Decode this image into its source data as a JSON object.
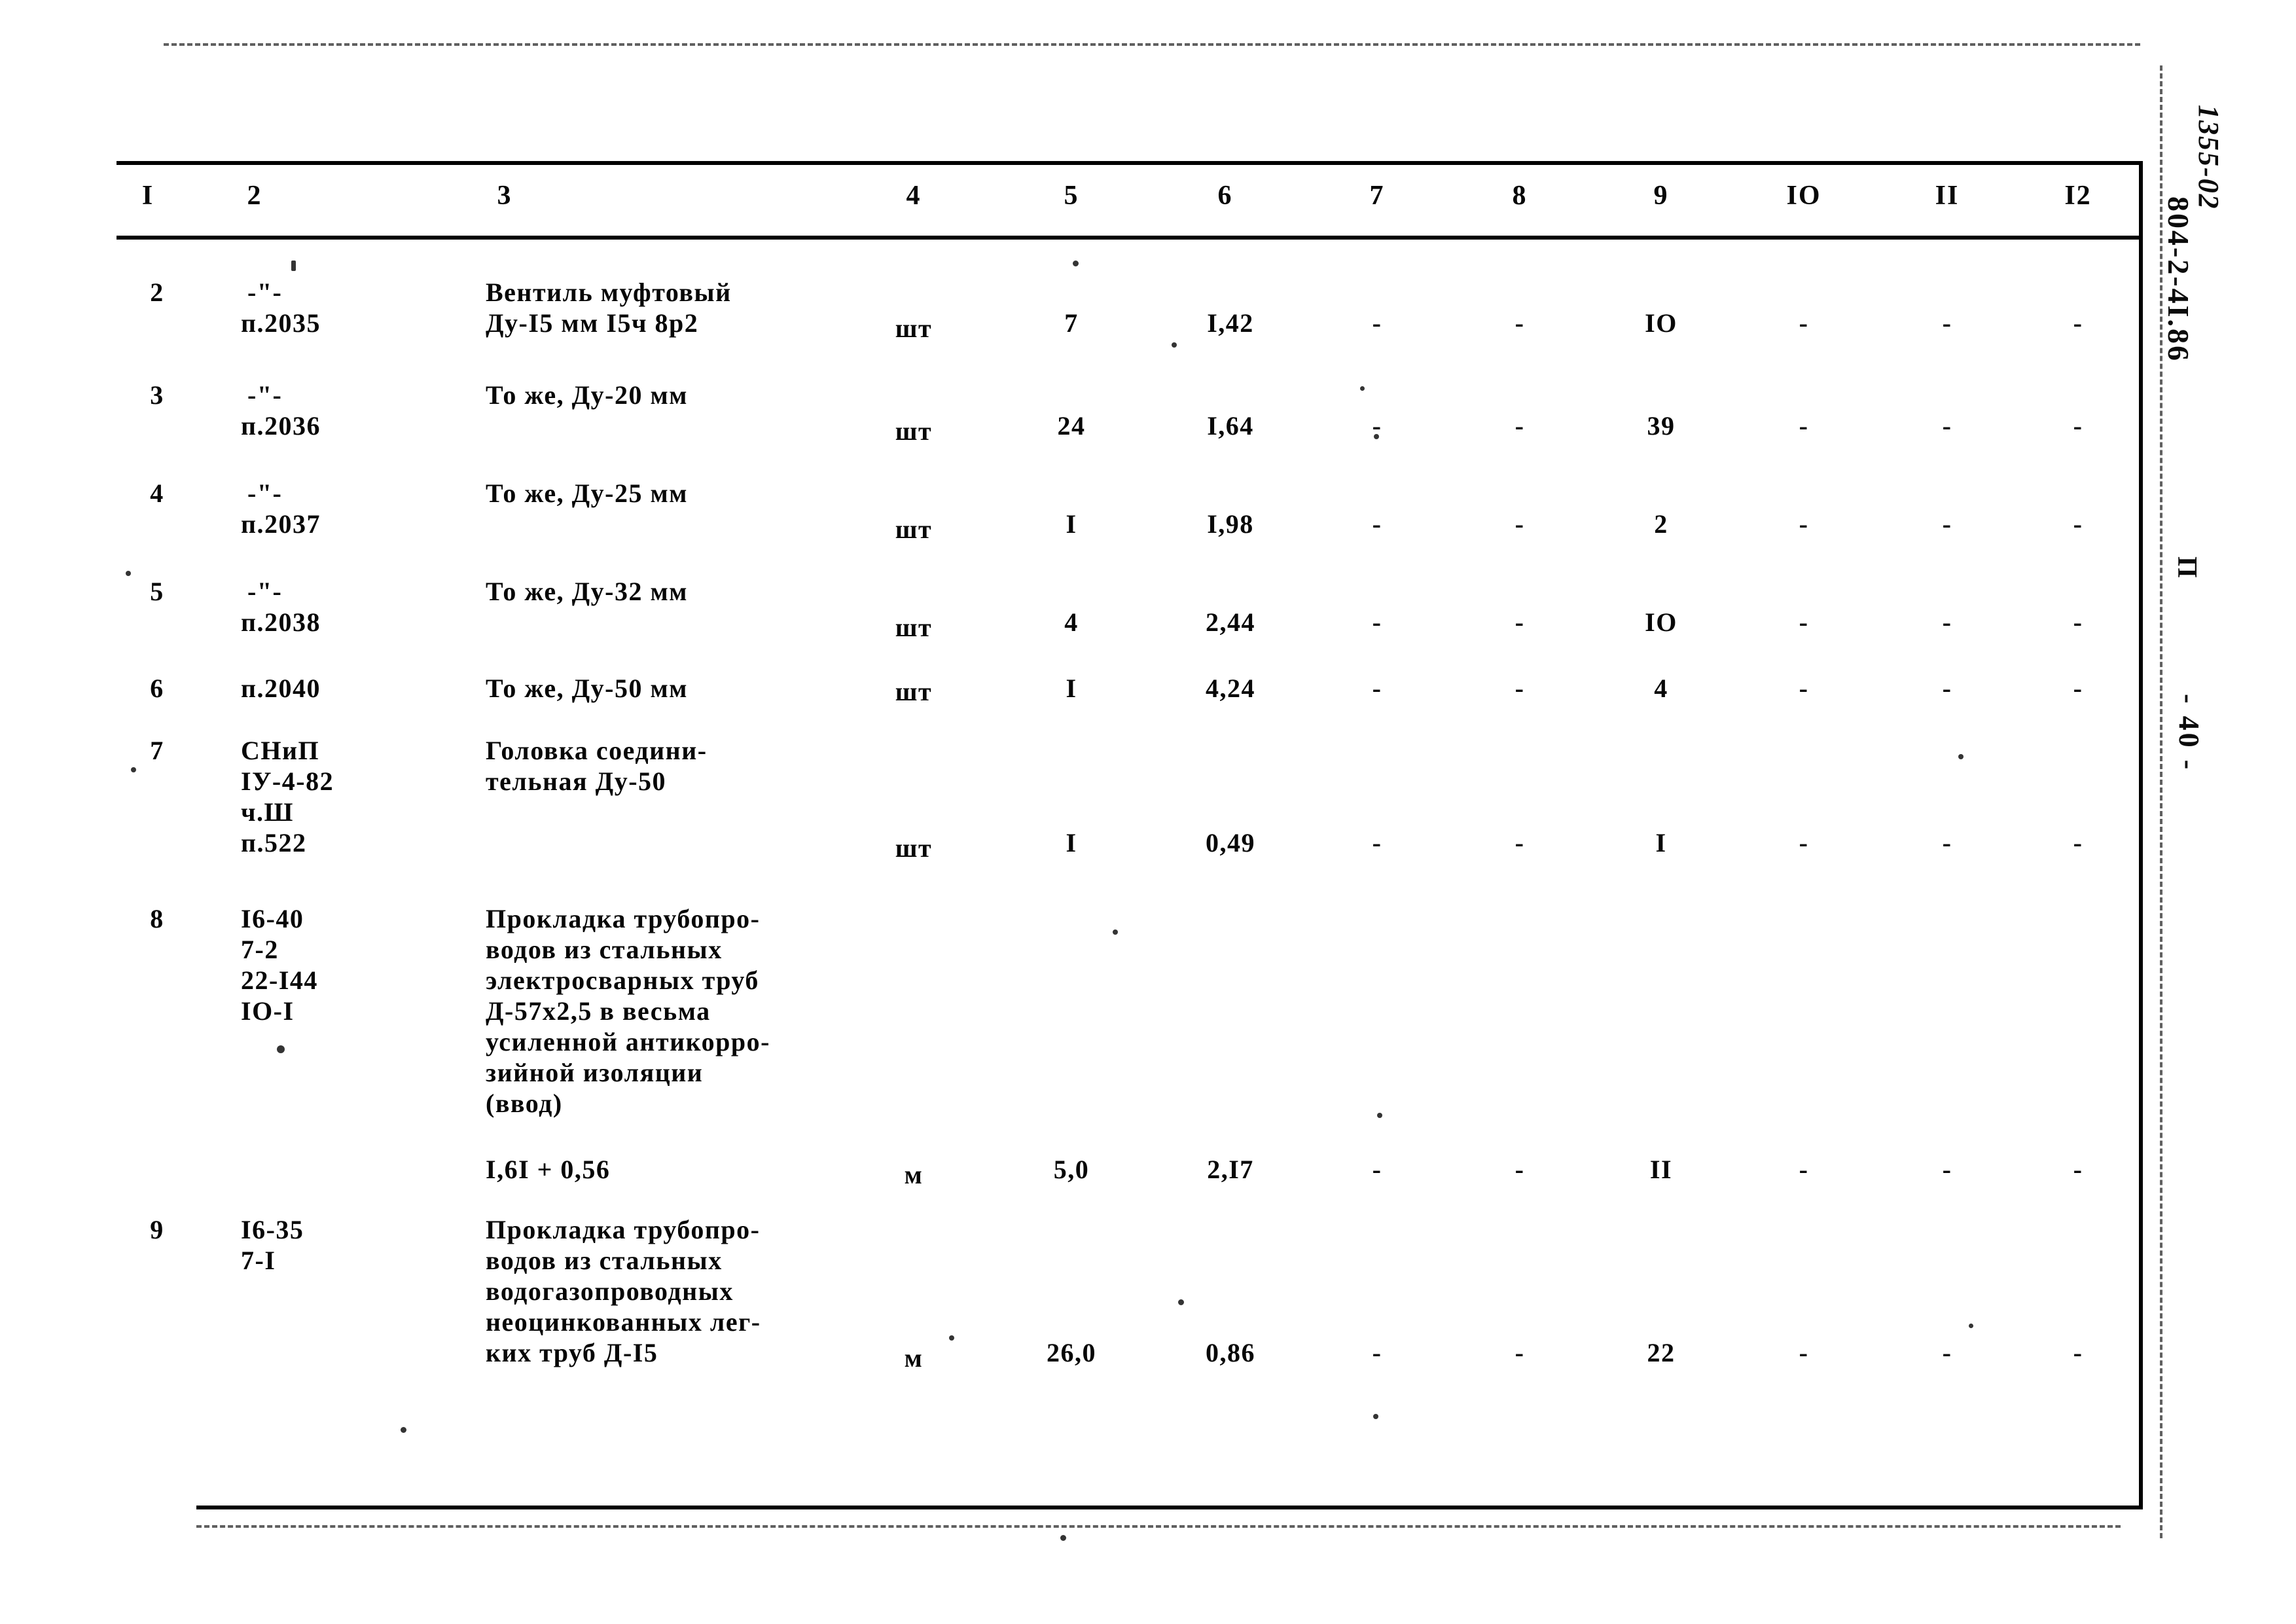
{
  "document": {
    "kind": "scanned-estimate-table",
    "margin_code_handwritten": "1355-02",
    "margin_code_printed": "804-2-4I.86",
    "margin_part": "П",
    "page_marker": "- 40 -"
  },
  "table": {
    "headers": [
      "I",
      "2",
      "3",
      "4",
      "5",
      "6",
      "7",
      "8",
      "9",
      "IO",
      "II",
      "I2"
    ],
    "rows": [
      {
        "num": "2",
        "code": [
          "-\"-",
          "п.2035"
        ],
        "desc": [
          "Вентиль муфтовый",
          "Ду-I5 мм I5ч 8р2"
        ],
        "unit": "шт",
        "c5": "7",
        "c6": "I,42",
        "c7": "-",
        "c8": "-",
        "c9": "IO",
        "c10": "-",
        "c11": "-",
        "c12": "-"
      },
      {
        "num": "3",
        "code": [
          "-\"-",
          "п.2036"
        ],
        "desc": [
          "То же, Ду-20 мм"
        ],
        "unit": "шт",
        "c5": "24",
        "c6": "I,64",
        "c7": "-",
        "c8": "-",
        "c9": "39",
        "c10": "-",
        "c11": "-",
        "c12": "-"
      },
      {
        "num": "4",
        "code": [
          "-\"-",
          "п.2037"
        ],
        "desc": [
          "То же, Ду-25 мм"
        ],
        "unit": "шт",
        "c5": "I",
        "c6": "I,98",
        "c7": "-",
        "c8": "-",
        "c9": "2",
        "c10": "-",
        "c11": "-",
        "c12": "-"
      },
      {
        "num": "5",
        "code": [
          "-\"-",
          "п.2038"
        ],
        "desc": [
          "То же, Ду-32 мм"
        ],
        "unit": "шт",
        "c5": "4",
        "c6": "2,44",
        "c7": "-",
        "c8": "-",
        "c9": "IO",
        "c10": "-",
        "c11": "-",
        "c12": "-"
      },
      {
        "num": "6",
        "code": [
          "п.2040"
        ],
        "desc": [
          "То же, Ду-50 мм"
        ],
        "unit": "шт",
        "c5": "I",
        "c6": "4,24",
        "c7": "-",
        "c8": "-",
        "c9": "4",
        "c10": "-",
        "c11": "-",
        "c12": "-"
      },
      {
        "num": "7",
        "code": [
          "СНиП",
          "IУ-4-82",
          "ч.Ш",
          "п.522"
        ],
        "desc": [
          "Головка соедини-",
          "тельная Ду-50"
        ],
        "unit": "шт",
        "c5": "I",
        "c6": "0,49",
        "c7": "-",
        "c8": "-",
        "c9": "I",
        "c10": "-",
        "c11": "-",
        "c12": "-"
      },
      {
        "num": "8",
        "code": [
          "I6-40",
          "7-2",
          "22-I44",
          "IO-I"
        ],
        "desc": [
          "Прокладка трубопро-",
          "водов из стальных",
          "электросварных труб",
          "Д-57х2,5 в весьма",
          "усиленной антикорро-",
          "зийной изоляции",
          "(ввод)"
        ],
        "formula": "I,6I + 0,56",
        "unit": "м",
        "c5": "5,0",
        "c6": "2,I7",
        "c7": "-",
        "c8": "-",
        "c9": "II",
        "c10": "-",
        "c11": "-",
        "c12": "-"
      },
      {
        "num": "9",
        "code": [
          "I6-35",
          "7-I"
        ],
        "desc": [
          "Прокладка трубопро-",
          "водов из стальных",
          "водогазопроводных",
          "неоцинкованных лег-",
          "ких труб Д-I5"
        ],
        "unit": "м",
        "c5": "26,0",
        "c6": "0,86",
        "c7": "-",
        "c8": "-",
        "c9": "22",
        "c10": "-",
        "c11": "-",
        "c12": "-"
      }
    ]
  }
}
